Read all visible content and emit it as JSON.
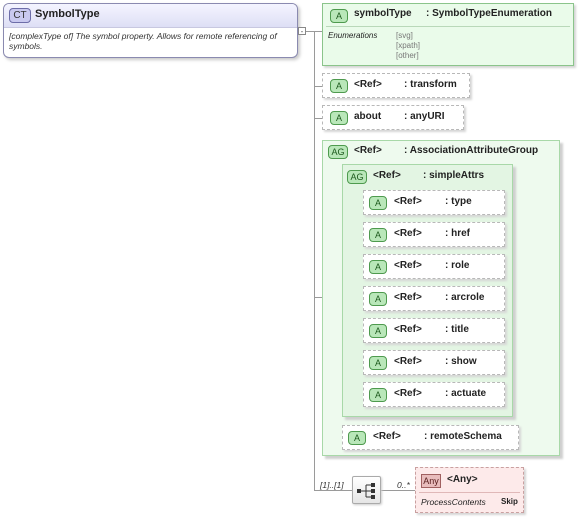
{
  "complex_type": {
    "badge": "CT",
    "name": "SymbolType",
    "doc": "[complexType of] The symbol property. Allows for remote referencing of symbols."
  },
  "attr_symbolType": {
    "badge": "A",
    "name": "symbolType",
    "type": ": SymbolTypeEnumeration",
    "enumerations_label": "Enumerations",
    "enumerations": [
      "[svg]",
      "[xpath]",
      "[other]"
    ]
  },
  "attr_transform": {
    "badge": "A",
    "name": "<Ref>",
    "type": ": transform"
  },
  "attr_about": {
    "badge": "A",
    "name": "about",
    "type": ": anyURI"
  },
  "group_assoc": {
    "badge": "AG",
    "name": "<Ref>",
    "type": ": AssociationAttributeGroup"
  },
  "group_simple": {
    "badge": "AG",
    "name": "<Ref>",
    "type": ": simpleAttrs"
  },
  "simple_attrs": [
    {
      "badge": "A",
      "name": "<Ref>",
      "type": ": type"
    },
    {
      "badge": "A",
      "name": "<Ref>",
      "type": ": href"
    },
    {
      "badge": "A",
      "name": "<Ref>",
      "type": ": role"
    },
    {
      "badge": "A",
      "name": "<Ref>",
      "type": ": arcrole"
    },
    {
      "badge": "A",
      "name": "<Ref>",
      "type": ": title"
    },
    {
      "badge": "A",
      "name": "<Ref>",
      "type": ": show"
    },
    {
      "badge": "A",
      "name": "<Ref>",
      "type": ": actuate"
    }
  ],
  "attr_remoteSchema": {
    "badge": "A",
    "name": "<Ref>",
    "type": ": remoteSchema"
  },
  "sequence": {
    "cardinality": "[1]..[1]"
  },
  "any": {
    "badge": "Any",
    "name": "<Any>",
    "cardinality": "0..*",
    "process_label": "ProcessContents",
    "process_value": "Skip"
  }
}
